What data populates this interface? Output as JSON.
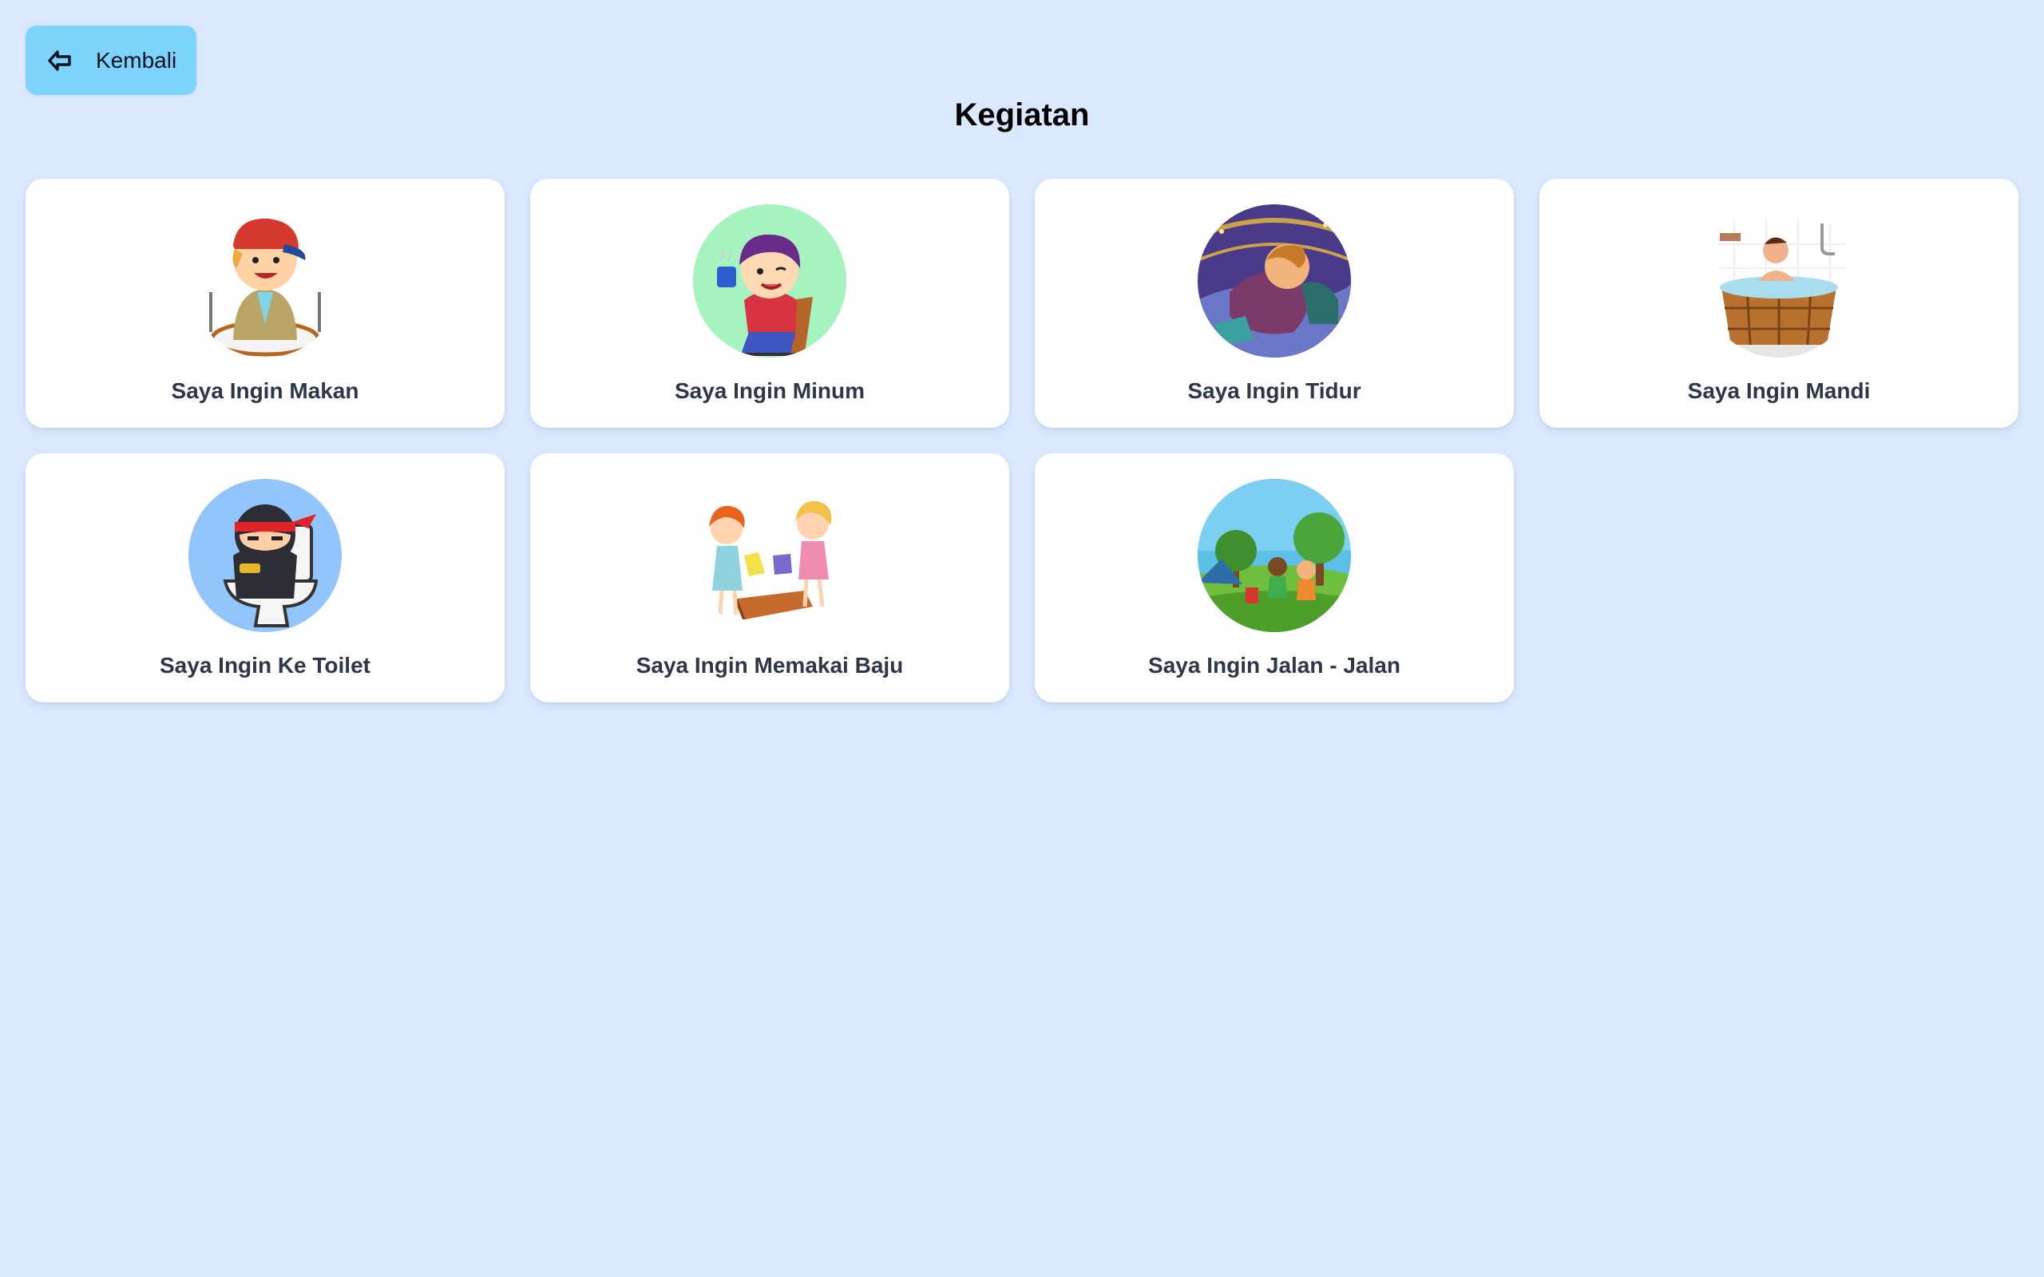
{
  "header": {
    "back_label": "Kembali",
    "back_icon": "arrow-left-icon",
    "title": "Kegiatan"
  },
  "activities": [
    {
      "label": "Saya Ingin Makan",
      "icon": "boy-eating-icon"
    },
    {
      "label": "Saya Ingin Minum",
      "icon": "boy-drinking-icon"
    },
    {
      "label": "Saya Ingin Tidur",
      "icon": "child-sleeping-icon"
    },
    {
      "label": "Saya Ingin Mandi",
      "icon": "bathtub-icon"
    },
    {
      "label": "Saya Ingin Ke Toilet",
      "icon": "ninja-toilet-icon"
    },
    {
      "label": "Saya Ingin Memakai Baju",
      "icon": "girls-dressing-icon"
    },
    {
      "label": "Saya Ingin Jalan - Jalan",
      "icon": "kids-outdoor-icon"
    }
  ],
  "colors": {
    "background": "#dbe9fe",
    "back_button": "#7dd3fc",
    "card": "#ffffff",
    "card_text": "#2d3748"
  }
}
